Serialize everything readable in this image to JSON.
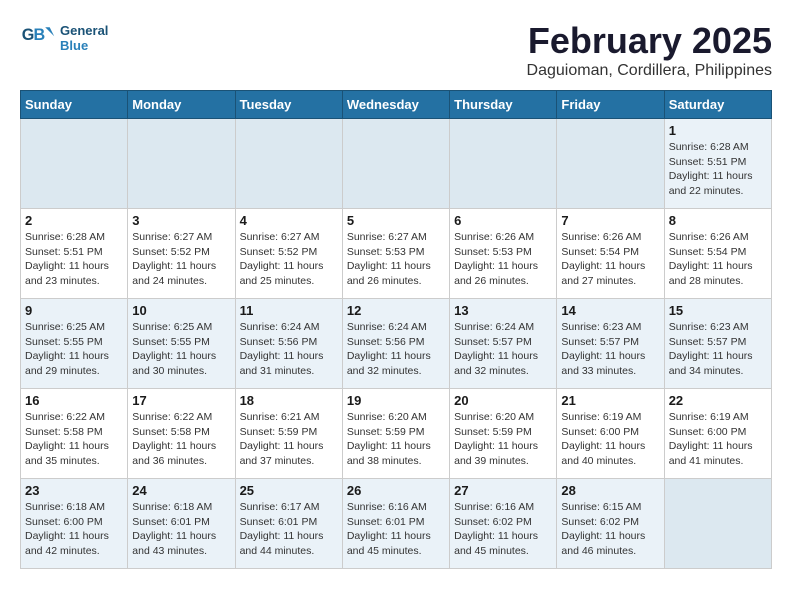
{
  "logo": {
    "text_general": "General",
    "text_blue": "Blue"
  },
  "title": "February 2025",
  "subtitle": "Daguioman, Cordillera, Philippines",
  "days_of_week": [
    "Sunday",
    "Monday",
    "Tuesday",
    "Wednesday",
    "Thursday",
    "Friday",
    "Saturday"
  ],
  "weeks": [
    [
      {
        "day": "",
        "info": ""
      },
      {
        "day": "",
        "info": ""
      },
      {
        "day": "",
        "info": ""
      },
      {
        "day": "",
        "info": ""
      },
      {
        "day": "",
        "info": ""
      },
      {
        "day": "",
        "info": ""
      },
      {
        "day": "1",
        "info": "Sunrise: 6:28 AM\nSunset: 5:51 PM\nDaylight: 11 hours and 22 minutes."
      }
    ],
    [
      {
        "day": "2",
        "info": "Sunrise: 6:28 AM\nSunset: 5:51 PM\nDaylight: 11 hours and 23 minutes."
      },
      {
        "day": "3",
        "info": "Sunrise: 6:27 AM\nSunset: 5:52 PM\nDaylight: 11 hours and 24 minutes."
      },
      {
        "day": "4",
        "info": "Sunrise: 6:27 AM\nSunset: 5:52 PM\nDaylight: 11 hours and 25 minutes."
      },
      {
        "day": "5",
        "info": "Sunrise: 6:27 AM\nSunset: 5:53 PM\nDaylight: 11 hours and 26 minutes."
      },
      {
        "day": "6",
        "info": "Sunrise: 6:26 AM\nSunset: 5:53 PM\nDaylight: 11 hours and 26 minutes."
      },
      {
        "day": "7",
        "info": "Sunrise: 6:26 AM\nSunset: 5:54 PM\nDaylight: 11 hours and 27 minutes."
      },
      {
        "day": "8",
        "info": "Sunrise: 6:26 AM\nSunset: 5:54 PM\nDaylight: 11 hours and 28 minutes."
      }
    ],
    [
      {
        "day": "9",
        "info": "Sunrise: 6:25 AM\nSunset: 5:55 PM\nDaylight: 11 hours and 29 minutes."
      },
      {
        "day": "10",
        "info": "Sunrise: 6:25 AM\nSunset: 5:55 PM\nDaylight: 11 hours and 30 minutes."
      },
      {
        "day": "11",
        "info": "Sunrise: 6:24 AM\nSunset: 5:56 PM\nDaylight: 11 hours and 31 minutes."
      },
      {
        "day": "12",
        "info": "Sunrise: 6:24 AM\nSunset: 5:56 PM\nDaylight: 11 hours and 32 minutes."
      },
      {
        "day": "13",
        "info": "Sunrise: 6:24 AM\nSunset: 5:57 PM\nDaylight: 11 hours and 32 minutes."
      },
      {
        "day": "14",
        "info": "Sunrise: 6:23 AM\nSunset: 5:57 PM\nDaylight: 11 hours and 33 minutes."
      },
      {
        "day": "15",
        "info": "Sunrise: 6:23 AM\nSunset: 5:57 PM\nDaylight: 11 hours and 34 minutes."
      }
    ],
    [
      {
        "day": "16",
        "info": "Sunrise: 6:22 AM\nSunset: 5:58 PM\nDaylight: 11 hours and 35 minutes."
      },
      {
        "day": "17",
        "info": "Sunrise: 6:22 AM\nSunset: 5:58 PM\nDaylight: 11 hours and 36 minutes."
      },
      {
        "day": "18",
        "info": "Sunrise: 6:21 AM\nSunset: 5:59 PM\nDaylight: 11 hours and 37 minutes."
      },
      {
        "day": "19",
        "info": "Sunrise: 6:20 AM\nSunset: 5:59 PM\nDaylight: 11 hours and 38 minutes."
      },
      {
        "day": "20",
        "info": "Sunrise: 6:20 AM\nSunset: 5:59 PM\nDaylight: 11 hours and 39 minutes."
      },
      {
        "day": "21",
        "info": "Sunrise: 6:19 AM\nSunset: 6:00 PM\nDaylight: 11 hours and 40 minutes."
      },
      {
        "day": "22",
        "info": "Sunrise: 6:19 AM\nSunset: 6:00 PM\nDaylight: 11 hours and 41 minutes."
      }
    ],
    [
      {
        "day": "23",
        "info": "Sunrise: 6:18 AM\nSunset: 6:00 PM\nDaylight: 11 hours and 42 minutes."
      },
      {
        "day": "24",
        "info": "Sunrise: 6:18 AM\nSunset: 6:01 PM\nDaylight: 11 hours and 43 minutes."
      },
      {
        "day": "25",
        "info": "Sunrise: 6:17 AM\nSunset: 6:01 PM\nDaylight: 11 hours and 44 minutes."
      },
      {
        "day": "26",
        "info": "Sunrise: 6:16 AM\nSunset: 6:01 PM\nDaylight: 11 hours and 45 minutes."
      },
      {
        "day": "27",
        "info": "Sunrise: 6:16 AM\nSunset: 6:02 PM\nDaylight: 11 hours and 45 minutes."
      },
      {
        "day": "28",
        "info": "Sunrise: 6:15 AM\nSunset: 6:02 PM\nDaylight: 11 hours and 46 minutes."
      },
      {
        "day": "",
        "info": ""
      }
    ]
  ]
}
